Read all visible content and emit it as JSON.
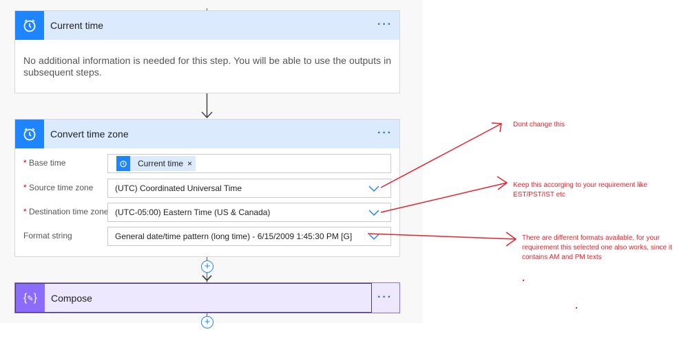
{
  "steps": {
    "current_time": {
      "title": "Current time",
      "body": "No additional information is needed for this step. You will be able to use the outputs in subsequent steps.",
      "icon": "alarm-clock-icon"
    },
    "convert": {
      "title": "Convert time zone",
      "icon": "alarm-clock-icon",
      "fields": [
        {
          "label": "Base time",
          "required": "*",
          "token": "Current time"
        },
        {
          "label": "Source time zone",
          "required": "*",
          "value": "(UTC) Coordinated Universal Time"
        },
        {
          "label": "Destination time zone",
          "required": "*",
          "value": "(UTC-05:00) Eastern Time (US & Canada)"
        },
        {
          "label": "Format string",
          "value": "General date/time pattern (long time) - 6/15/2009 1:45:30 PM [G]"
        }
      ]
    },
    "compose": {
      "title": "Compose",
      "icon": "compose-braces-icon"
    }
  },
  "more_label": "···",
  "annotations": {
    "a1": "Dont change this",
    "a2": "Keep this accorging to your requirement like EST/PST/IST etc",
    "a3": "There are different formats available, for your requirement this selected one also works, since it contains AM and PM texts"
  },
  "colors": {
    "accent": "#1f85ff",
    "compose": "#8c6cff",
    "annotation": "#e8202a"
  }
}
